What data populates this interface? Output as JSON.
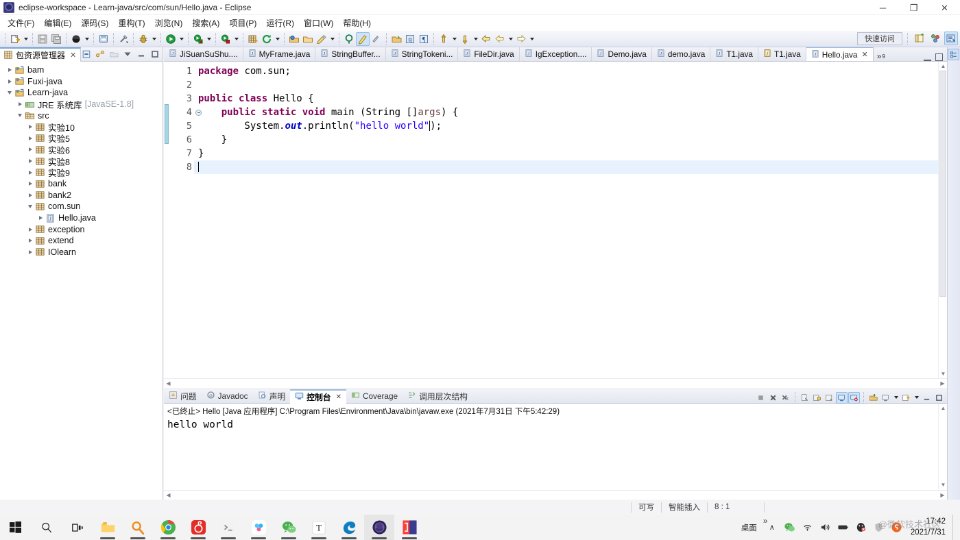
{
  "window": {
    "title": "eclipse-workspace - Learn-java/src/com/sun/Hello.java - Eclipse",
    "app_icon": "eclipse-icon",
    "minimize": "─",
    "maximize": "❐",
    "close": "✕"
  },
  "menubar": {
    "items": [
      {
        "label": "文件(F)",
        "name": "menu-file"
      },
      {
        "label": "编辑(E)",
        "name": "menu-edit"
      },
      {
        "label": "源码(S)",
        "name": "menu-source"
      },
      {
        "label": "重构(T)",
        "name": "menu-refactor"
      },
      {
        "label": "浏览(N)",
        "name": "menu-navigate"
      },
      {
        "label": "搜索(A)",
        "name": "menu-search"
      },
      {
        "label": "项目(P)",
        "name": "menu-project"
      },
      {
        "label": "运行(R)",
        "name": "menu-run"
      },
      {
        "label": "窗口(W)",
        "name": "menu-window"
      },
      {
        "label": "帮助(H)",
        "name": "menu-help"
      }
    ]
  },
  "toolbar": {
    "quick_access": "快速访问",
    "icons": [
      "new-wizard-icon",
      "save-icon",
      "save-all-icon",
      "skip-breakpoints-icon",
      "new-java-class-icon",
      "link-broken-icon",
      "debug-icon",
      "run-icon",
      "run-last-tool-icon",
      "external-tools-icon",
      "new-package-icon",
      "refresh-icon",
      "open-type-icon",
      "open-task-icon",
      "search-icon",
      "annotation-icon",
      "toggle-mark-occurrences-icon",
      "previous-annotation-icon",
      "next-annotation-icon",
      "last-edit-location-icon",
      "back-icon",
      "forward-icon"
    ],
    "perspective_icons": [
      "open-perspective-icon",
      "java-browsing-perspective-icon",
      "java-perspective-icon"
    ]
  },
  "package_explorer": {
    "tab_label": "包资源管理器",
    "tab_close": "✕",
    "toolbar_icons": [
      "collapse-all-icon",
      "link-with-editor-icon",
      "focus-on-active-task-icon",
      "view-menu-icon",
      "minimize-icon",
      "maximize-icon"
    ],
    "tree": [
      {
        "label": "bam",
        "indent": 0,
        "expanded": false,
        "icon": "java-project-icon",
        "sub": ""
      },
      {
        "label": "Fuxi-java",
        "indent": 0,
        "expanded": false,
        "icon": "java-project-icon",
        "sub": ""
      },
      {
        "label": "Learn-java",
        "indent": 0,
        "expanded": true,
        "icon": "java-project-icon",
        "sub": ""
      },
      {
        "label": "JRE 系统库",
        "indent": 1,
        "expanded": false,
        "icon": "jre-library-icon",
        "sub": "[JavaSE-1.8]"
      },
      {
        "label": "src",
        "indent": 1,
        "expanded": true,
        "icon": "source-folder-icon",
        "sub": ""
      },
      {
        "label": "实验10",
        "indent": 2,
        "expanded": false,
        "icon": "package-icon",
        "sub": ""
      },
      {
        "label": "实验5",
        "indent": 2,
        "expanded": false,
        "icon": "package-icon",
        "sub": ""
      },
      {
        "label": "实验6",
        "indent": 2,
        "expanded": false,
        "icon": "package-icon",
        "sub": ""
      },
      {
        "label": "实验8",
        "indent": 2,
        "expanded": false,
        "icon": "package-icon",
        "sub": ""
      },
      {
        "label": "实验9",
        "indent": 2,
        "expanded": false,
        "icon": "package-icon",
        "sub": ""
      },
      {
        "label": "bank",
        "indent": 2,
        "expanded": false,
        "icon": "package-icon",
        "sub": ""
      },
      {
        "label": "bank2",
        "indent": 2,
        "expanded": false,
        "icon": "package-icon",
        "sub": ""
      },
      {
        "label": "com.sun",
        "indent": 2,
        "expanded": true,
        "icon": "package-icon",
        "sub": ""
      },
      {
        "label": "Hello.java",
        "indent": 3,
        "expanded": false,
        "icon": "java-file-icon",
        "sub": ""
      },
      {
        "label": "exception",
        "indent": 2,
        "expanded": false,
        "icon": "package-icon",
        "sub": ""
      },
      {
        "label": "extend",
        "indent": 2,
        "expanded": false,
        "icon": "package-icon",
        "sub": ""
      },
      {
        "label": "IOlearn",
        "indent": 2,
        "expanded": false,
        "icon": "package-icon",
        "sub": ""
      }
    ]
  },
  "editor": {
    "tabs": [
      {
        "label": "JiSuanSuShu....",
        "active": false,
        "icon": "java-file-icon"
      },
      {
        "label": "MyFrame.java",
        "active": false,
        "icon": "java-file-icon"
      },
      {
        "label": "StringBuffer...",
        "active": false,
        "icon": "java-file-icon"
      },
      {
        "label": "StringTokeni...",
        "active": false,
        "icon": "java-file-icon"
      },
      {
        "label": "FileDir.java",
        "active": false,
        "icon": "java-file-icon"
      },
      {
        "label": "IgException....",
        "active": false,
        "icon": "java-file-icon"
      },
      {
        "label": "Demo.java",
        "active": false,
        "icon": "java-file-icon"
      },
      {
        "label": "demo.java",
        "active": false,
        "icon": "java-file-icon"
      },
      {
        "label": "T1.java",
        "active": false,
        "icon": "java-file-icon"
      },
      {
        "label": "T1.java",
        "active": false,
        "icon": "java-file-dirty-icon"
      },
      {
        "label": "Hello.java",
        "active": true,
        "icon": "java-file-icon",
        "close": "✕"
      }
    ],
    "more_tabs": "»",
    "more_count": "9",
    "line_numbers": [
      "1",
      "2",
      "3",
      "4",
      "5",
      "6",
      "7",
      "8"
    ],
    "code_lines": [
      {
        "n": 1,
        "segments": [
          {
            "t": "package",
            "c": "kw"
          },
          {
            "t": " com.sun;",
            "c": ""
          }
        ]
      },
      {
        "n": 2,
        "segments": [
          {
            "t": "",
            "c": ""
          }
        ]
      },
      {
        "n": 3,
        "segments": [
          {
            "t": "public class ",
            "c": "kw"
          },
          {
            "t": "Hello {",
            "c": ""
          }
        ]
      },
      {
        "n": 4,
        "fold": true,
        "segments": [
          {
            "t": "    ",
            "c": ""
          },
          {
            "t": "public static void ",
            "c": "kw"
          },
          {
            "t": "main (String []",
            "c": ""
          },
          {
            "t": "args",
            "c": "par"
          },
          {
            "t": ") {",
            "c": ""
          }
        ]
      },
      {
        "n": 5,
        "segments": [
          {
            "t": "        System.",
            "c": ""
          },
          {
            "t": "out",
            "c": "fld"
          },
          {
            "t": ".println(",
            "c": ""
          },
          {
            "t": "\"hello world\"",
            "c": "str"
          },
          {
            "t": ");",
            "c": "",
            "caret": true
          }
        ]
      },
      {
        "n": 6,
        "segments": [
          {
            "t": "    }",
            "c": ""
          }
        ]
      },
      {
        "n": 7,
        "segments": [
          {
            "t": "}",
            "c": ""
          }
        ]
      },
      {
        "n": 8,
        "highlight": true,
        "segments": [
          {
            "t": "",
            "c": "",
            "caret": true
          }
        ]
      }
    ]
  },
  "console": {
    "tabs": [
      {
        "label": "问题",
        "active": false,
        "icon": "problems-icon"
      },
      {
        "label": "Javadoc",
        "active": false,
        "icon": "javadoc-icon"
      },
      {
        "label": "声明",
        "active": false,
        "icon": "declaration-icon"
      },
      {
        "label": "控制台",
        "active": true,
        "icon": "console-icon",
        "close": "✕"
      },
      {
        "label": "Coverage",
        "active": false,
        "icon": "coverage-icon"
      },
      {
        "label": "调用层次结构",
        "active": false,
        "icon": "call-hierarchy-icon"
      }
    ],
    "header": "<已终止> Hello [Java 应用程序] C:\\Program Files\\Environment\\Java\\bin\\javaw.exe  (2021年7月31日 下午5:42:29)",
    "output": "hello world",
    "toolbar_icons": [
      "terminate-icon",
      "remove-launch-icon",
      "remove-all-launches-icon",
      "clear-console-icon",
      "scroll-lock-icon",
      "word-wrap-icon",
      "show-console-on-output-icon",
      "pin-console-icon",
      "display-selected-console-icon",
      "open-console-icon",
      "view-menu-icon",
      "minimize-icon",
      "maximize-icon"
    ]
  },
  "statusbar": {
    "writable": "可写",
    "insert_mode": "智能插入",
    "position": "8 : 1"
  },
  "taskbar": {
    "buttons": [
      {
        "name": "start-button",
        "icon": "windows-logo-icon"
      },
      {
        "name": "search-button",
        "icon": "search-icon"
      },
      {
        "name": "task-view-button",
        "icon": "task-view-icon"
      },
      {
        "name": "file-explorer-button",
        "icon": "folder-icon",
        "running": true
      },
      {
        "name": "everything-search-button",
        "icon": "magnifier-orange-icon",
        "running": true
      },
      {
        "name": "chrome-button",
        "icon": "chrome-icon",
        "running": true
      },
      {
        "name": "netease-music-button",
        "icon": "netease-music-icon",
        "running": true
      },
      {
        "name": "terminal-button",
        "icon": "terminal-icon",
        "running": true
      },
      {
        "name": "drive-button",
        "icon": "baidu-netdisk-icon",
        "running": true
      },
      {
        "name": "wechat-button",
        "icon": "wechat-icon",
        "running": true
      },
      {
        "name": "typora-button",
        "icon": "typora-icon",
        "running": true
      },
      {
        "name": "edge-button",
        "icon": "edge-icon",
        "running": true
      },
      {
        "name": "eclipse-button",
        "icon": "eclipse-icon",
        "running": true,
        "active": true
      },
      {
        "name": "intellij-button",
        "icon": "intellij-idea-icon",
        "running": true
      }
    ],
    "tray": {
      "desktop_label": "桌面",
      "overflow": "»",
      "chevron": "∧",
      "icons": [
        "wechat-tray-icon",
        "wifi-icon",
        "volume-icon",
        "battery-icon",
        "qq-icon",
        "safe-icon",
        "sogou-input-icon"
      ],
      "time": "17:42",
      "date": "2021/7/31",
      "watermark": "@微软技术社区"
    }
  }
}
